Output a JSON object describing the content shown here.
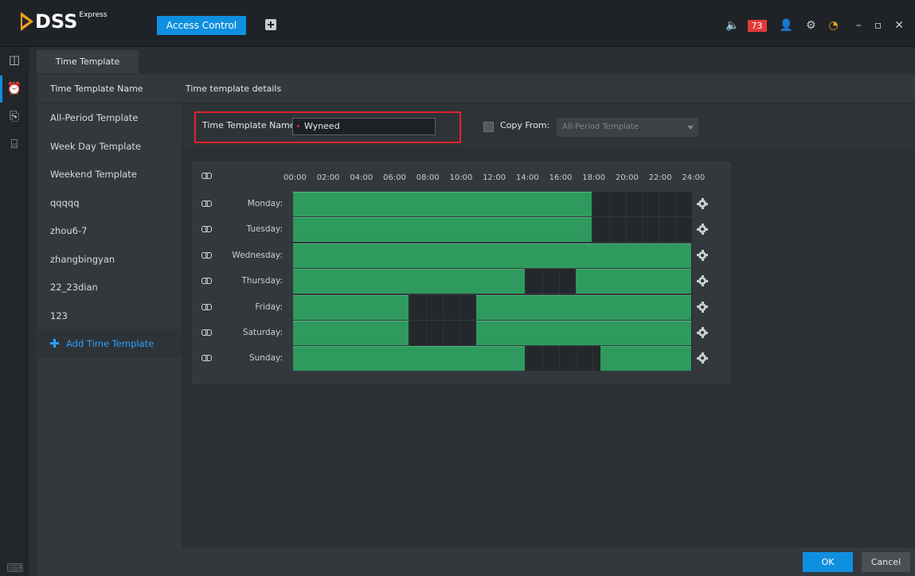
{
  "app": {
    "logo_text": "DSS",
    "logo_superscript": "Express"
  },
  "titlebar": {
    "active_module": "Access Control",
    "alarm_count": "73",
    "icons": [
      "speaker-icon",
      "user-icon",
      "gear-icon",
      "performance-icon",
      "minimize-icon",
      "maximize-icon",
      "close-icon"
    ]
  },
  "rail": {
    "icons": [
      "door-icon",
      "alarm-clock-icon",
      "device-lock-icon",
      "briefcase-icon",
      "keyboard-icon"
    ]
  },
  "tabs": {
    "active": "Time Template"
  },
  "list": {
    "header": "Time Template Name",
    "items": [
      "All-Period Template",
      "Week Day Template",
      "Weekend Template",
      "qqqqq",
      "zhou6-7",
      "zhangbingyan",
      "22_23dian",
      "123"
    ],
    "add_label": "Add Time Template"
  },
  "details": {
    "title": "Time template details",
    "name_label": "Time Template Name:",
    "name_value": "Wyneed",
    "copy_label": "Copy From:",
    "copy_value": "All-Period Template"
  },
  "colors": {
    "accent": "#0f8fe0",
    "period": "#2e9a5e",
    "highlight_box": "#e0242c",
    "alarm": "#e23b3b"
  },
  "schedule": {
    "hours": [
      "00:00",
      "02:00",
      "04:00",
      "06:00",
      "08:00",
      "10:00",
      "12:00",
      "14:00",
      "16:00",
      "18:00",
      "20:00",
      "22:00",
      "24:00"
    ],
    "days": [
      {
        "label": "Monday:",
        "periods": [
          [
            0,
            18
          ]
        ]
      },
      {
        "label": "Tuesday:",
        "periods": [
          [
            0,
            18
          ]
        ]
      },
      {
        "label": "Wednesday:",
        "periods": [
          [
            0,
            24
          ]
        ]
      },
      {
        "label": "Thursday:",
        "periods": [
          [
            0,
            14
          ],
          [
            17,
            24
          ]
        ]
      },
      {
        "label": "Friday:",
        "periods": [
          [
            0,
            7
          ],
          [
            11,
            24
          ]
        ]
      },
      {
        "label": "Saturday:",
        "periods": [
          [
            0,
            7
          ],
          [
            11,
            24
          ]
        ]
      },
      {
        "label": "Sunday:",
        "periods": [
          [
            0,
            14
          ],
          [
            18.5,
            24
          ]
        ]
      }
    ]
  },
  "footer": {
    "ok_label": "OK",
    "cancel_label": "Cancel"
  }
}
